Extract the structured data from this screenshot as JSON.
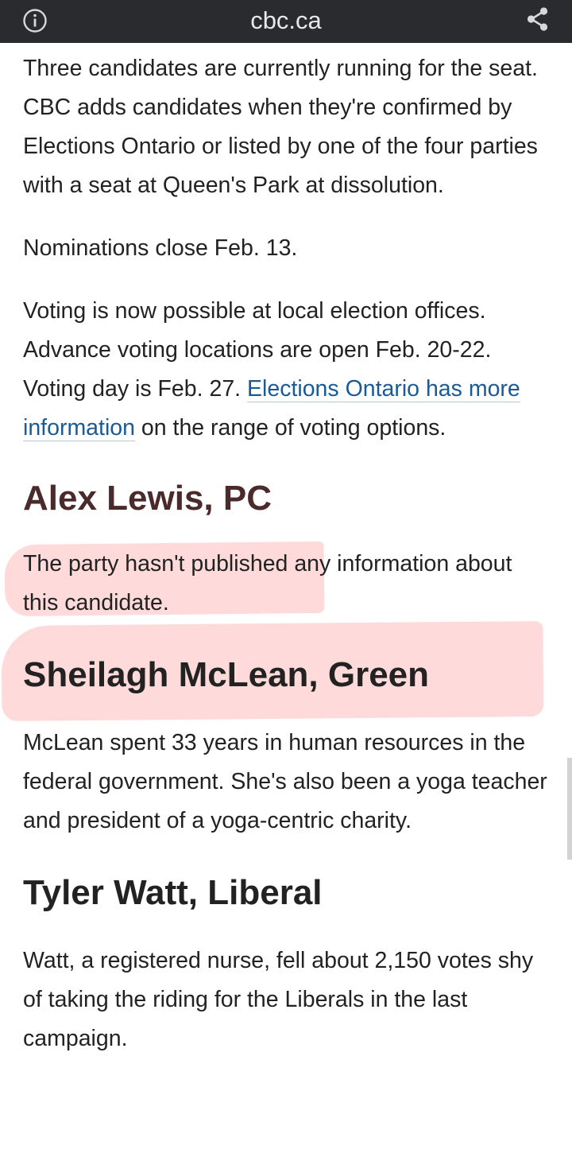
{
  "topbar": {
    "domain": "cbc.ca",
    "left_icon": "info-icon",
    "right_icon": "share-icon"
  },
  "article": {
    "intro": "Three candidates are currently running for the seat. CBC adds candidates when they're confirmed by Elections Ontario or listed by one of the four parties with a seat at Queen's Park at dissolution.",
    "nominations": "Nominations close Feb. 13.",
    "voting_text": "Voting is now possible at local election offices. Advance voting locations are open Feb. 20-22. Voting day is Feb. 27. ",
    "voting_link": "Elections Ontario has more information",
    "voting_text_after": " on the range of voting options.",
    "candidates": [
      {
        "heading": "Alex Lewis, PC",
        "bio": "The party hasn't published any information about this candidate."
      },
      {
        "heading": "Sheilagh McLean, Green",
        "bio": "McLean spent 33 years in human resources in the federal government. She's also been a yoga teacher and president of a yoga-centric charity."
      },
      {
        "heading": "Tyler Watt, Liberal",
        "bio": "Watt, a registered nurse, fell about 2,150 votes shy of taking the riding for the Liberals in the last campaign."
      }
    ]
  },
  "colors": {
    "topbar_bg": "#2a2b2e",
    "link": "#1a5a96",
    "highlight": "#ffb4b4"
  }
}
